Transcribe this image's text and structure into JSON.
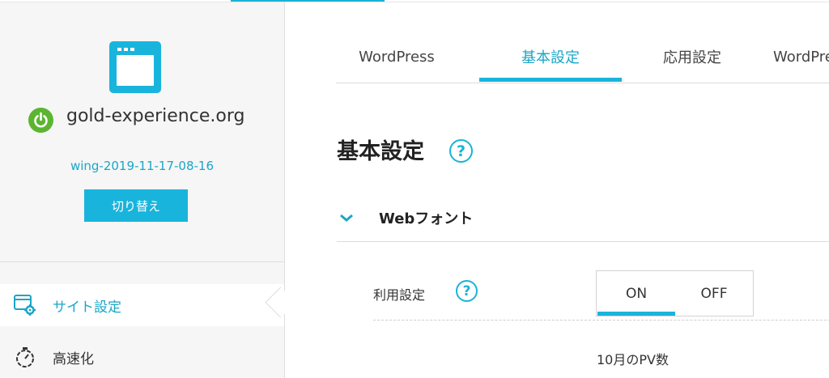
{
  "colors": {
    "accent": "#19b4dc",
    "power_green": "#5cb531",
    "sidebar_bg": "#f6f6f6"
  },
  "sidebar": {
    "site_icon": "browser-window-icon",
    "status_icon": "power-icon",
    "domain": "gold-experience.org",
    "server_id": "wing-2019-11-17-08-16",
    "switch_label": "切り替え",
    "nav": [
      {
        "label": "サイト設定",
        "icon": "site-settings-icon",
        "active": true
      },
      {
        "label": "高速化",
        "icon": "stopwatch-icon",
        "active": false
      }
    ]
  },
  "tabs": [
    {
      "label": "WordPress"
    },
    {
      "label": "基本設定",
      "active": true
    },
    {
      "label": "応用設定"
    },
    {
      "label": "WordPre"
    }
  ],
  "main": {
    "title": "基本設定",
    "help_icon": "?",
    "section": {
      "title": "Webフォント",
      "icon": "chevron-down-icon"
    },
    "usage_row": {
      "label": "利用設定",
      "help": "?",
      "on_label": "ON",
      "off_label": "OFF",
      "selected": "ON"
    },
    "pv_label": "10月のPV数"
  }
}
